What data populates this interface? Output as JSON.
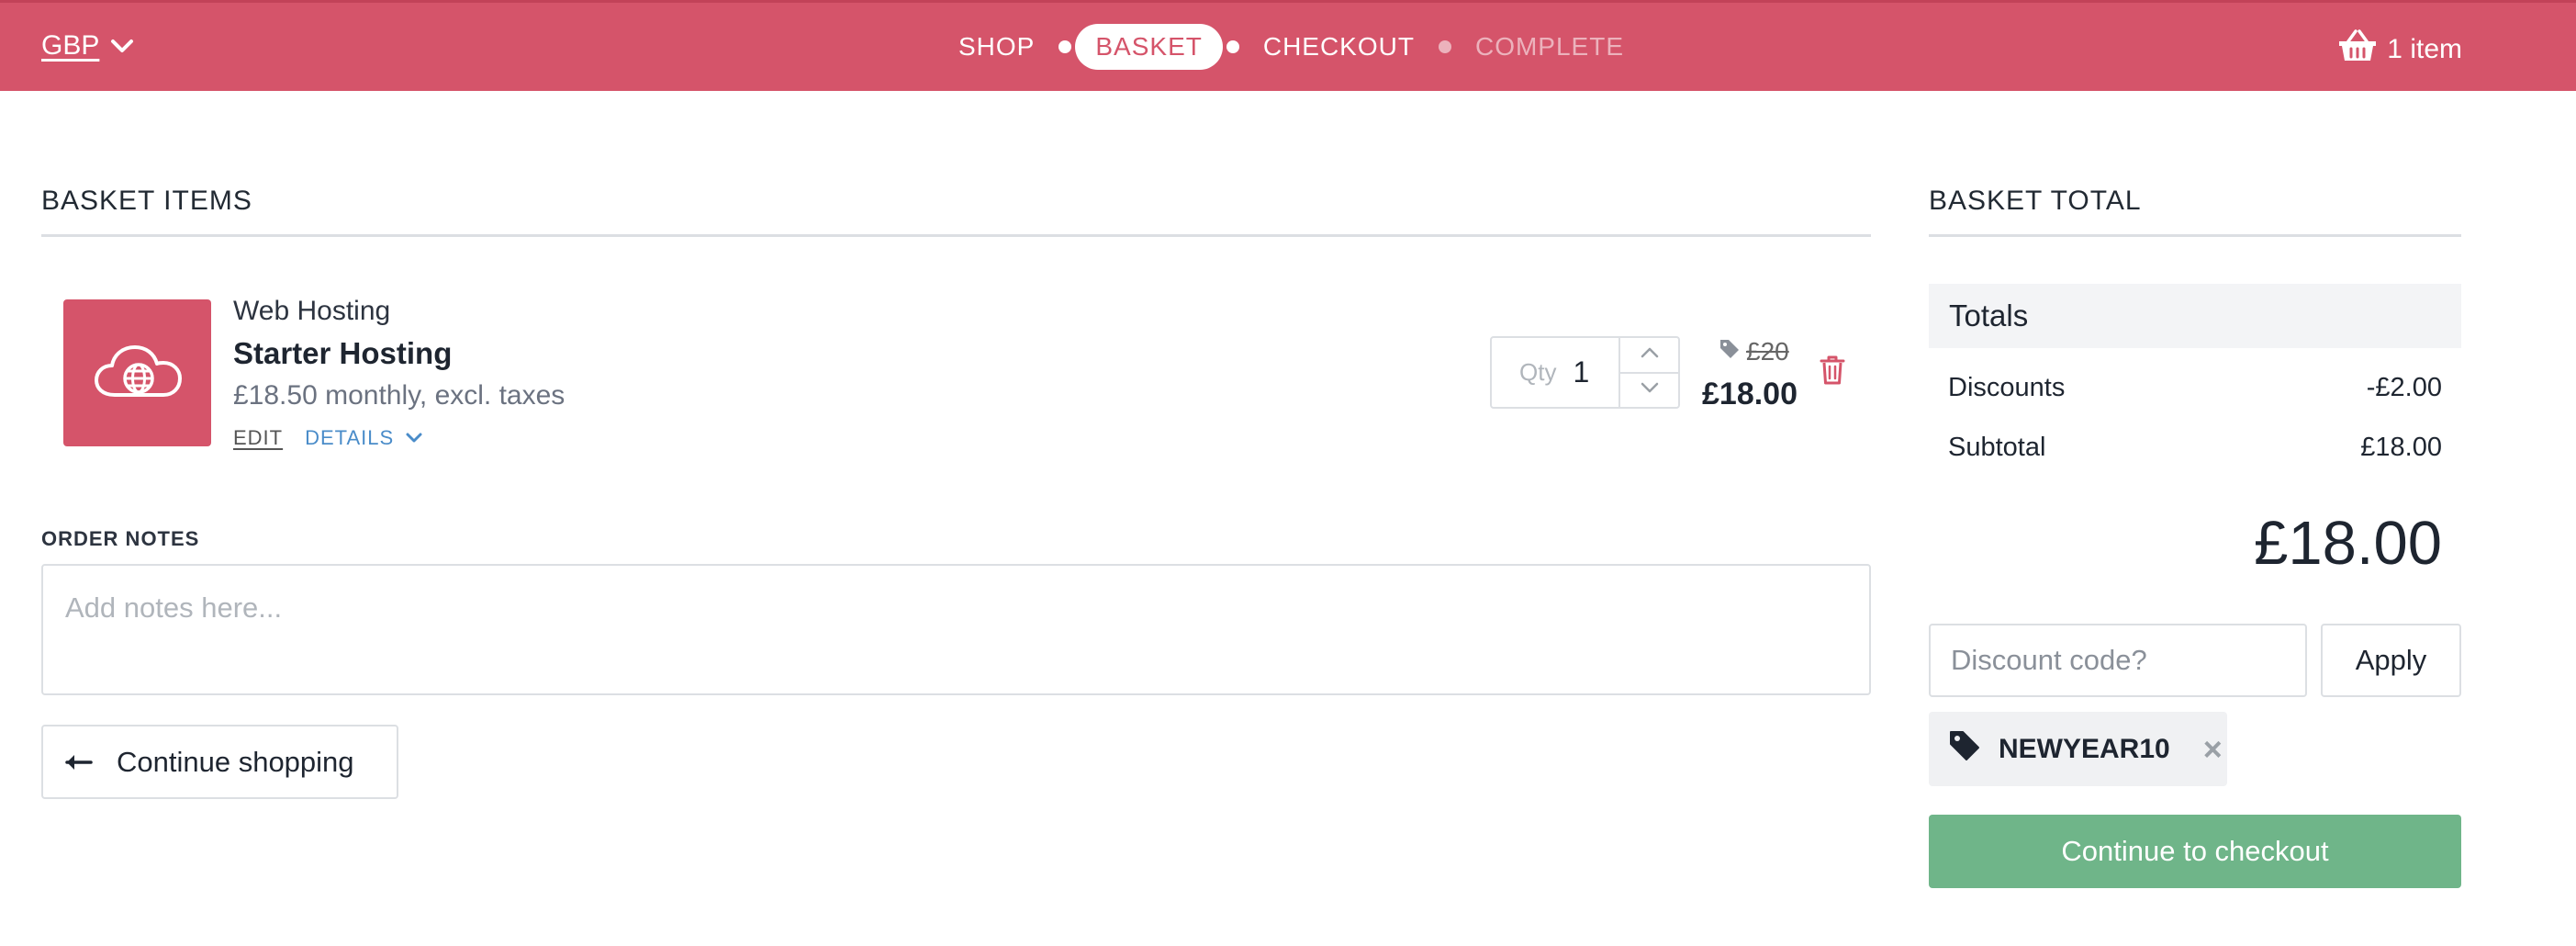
{
  "header": {
    "currency": "GBP",
    "steps": [
      {
        "label": "SHOP",
        "state": "done"
      },
      {
        "label": "BASKET",
        "state": "active"
      },
      {
        "label": "CHECKOUT",
        "state": "next"
      },
      {
        "label": "COMPLETE",
        "state": "disabled"
      }
    ],
    "cart_count_label": "1 item"
  },
  "basket": {
    "title": "BASKET ITEMS",
    "item": {
      "category": "Web Hosting",
      "name": "Starter Hosting",
      "price_text": "£18.50 monthly, excl. taxes",
      "edit_label": "EDIT",
      "details_label": "DETAILS",
      "qty_label": "Qty",
      "qty_value": "1",
      "original_price": "£20",
      "price": "£18.00"
    }
  },
  "notes": {
    "label": "ORDER NOTES",
    "placeholder": "Add notes here..."
  },
  "continue_shopping_label": "Continue shopping",
  "totals": {
    "title": "BASKET TOTAL",
    "panel_title": "Totals",
    "rows": [
      {
        "label": "Discounts",
        "value": "-£2.00"
      },
      {
        "label": "Subtotal",
        "value": "£18.00"
      }
    ],
    "grand_total": "£18.00",
    "discount_placeholder": "Discount code?",
    "apply_label": "Apply",
    "applied_code": "NEWYEAR10",
    "checkout_label": "Continue to checkout"
  },
  "colors": {
    "brand": "#d5546a",
    "checkout": "#6fb589",
    "link": "#4a8cc9"
  }
}
